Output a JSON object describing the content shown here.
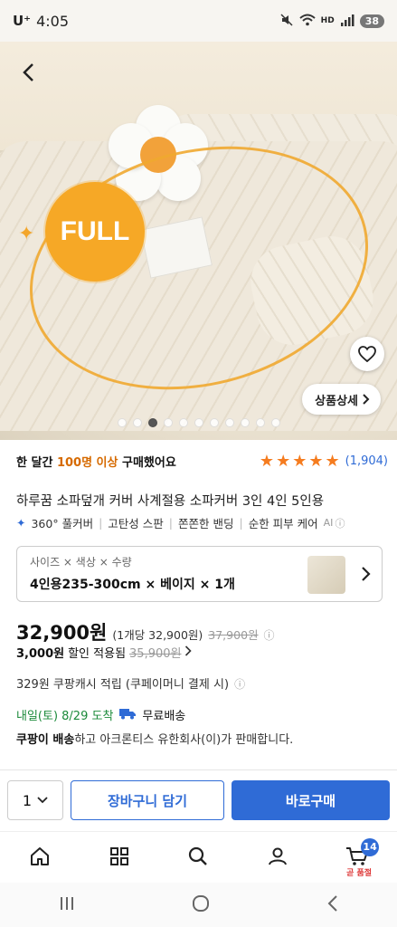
{
  "status_bar": {
    "carrier": "U⁺",
    "time": "4:05",
    "battery": "38"
  },
  "hero": {
    "badge": "FULL",
    "detail_button": "상품상세",
    "dots_total": 11,
    "dots_active_index": 2
  },
  "buy_info": {
    "prefix": "한 달간 ",
    "highlight": "100명 이상",
    "suffix": " 구매했어요",
    "rating": 5,
    "review_count": "(1,904)"
  },
  "product": {
    "title": "하루꿈 소파덮개 커버 사계절용 소파커버 3인 4인 5인용",
    "features": [
      "360° 풀커버",
      "고탄성 스판",
      "쫀쫀한 밴딩",
      "순한 피부 케어"
    ],
    "ai_label": "AI"
  },
  "option": {
    "label": "사이즈 × 색상 × 수량",
    "value": "4인용235-300cm × 베이지 × 1개"
  },
  "price": {
    "sale": "32,900원",
    "unit": "(1개당 32,900원)",
    "original": "37,900원",
    "discount_amount": "3,000원",
    "discount_text": "할인 적용됨",
    "discount_strike": "35,900원",
    "cash": "329원 쿠팡캐시 적립 (쿠페이머니 결제 시)"
  },
  "delivery": {
    "date": "내일(토) 8/29 도착",
    "shipping": "무료배송",
    "seller_bold": "쿠팡이 배송",
    "seller_rest": "하고 아크론티스 유한회사(이)가 판매합니다."
  },
  "actions": {
    "qty": "1",
    "cart": "장바구니 담기",
    "buy": "바로구매"
  },
  "tabbar": {
    "cart_badge": "14",
    "cart_sub": "곧 품절"
  },
  "colors": {
    "accent_blue": "#2f6bd6",
    "star_orange": "#f57c1f",
    "delivery_green": "#1b8a3a",
    "badge_orange": "#f6a826"
  }
}
